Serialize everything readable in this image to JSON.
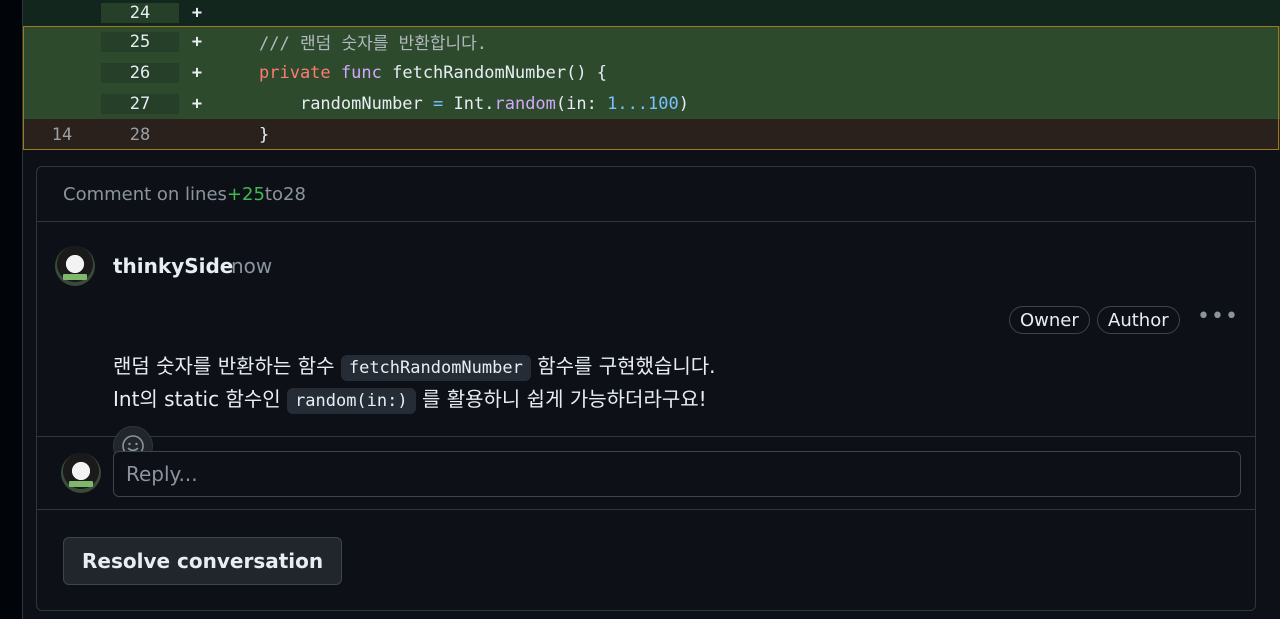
{
  "diff": {
    "rows": [
      {
        "old": "",
        "new": "24",
        "marker": "+"
      },
      {
        "old": "",
        "new": "25",
        "marker": "+"
      },
      {
        "old": "",
        "new": "26",
        "marker": "+"
      },
      {
        "old": "",
        "new": "27",
        "marker": "+"
      },
      {
        "old": "14",
        "new": "28",
        "marker": ""
      }
    ],
    "code": {
      "comment_line": "/// 랜덤 숫자를 반환합니다.",
      "private_kw": "private",
      "func_kw": "func",
      "func_name": "fetchRandomNumber() {",
      "assign_lhs": "randomNumber",
      "assign_op": "=",
      "type_name": "Int.",
      "method_name": "random",
      "arg_open": "(in: ",
      "range_value": "1...100",
      "arg_close": ")",
      "closing_brace": "}"
    }
  },
  "thread": {
    "header_prefix": "Comment on lines ",
    "header_start": "+25",
    "header_mid": " to ",
    "header_end": "28",
    "comment": {
      "author": "thinkySide",
      "time": "now",
      "badges": [
        "Owner",
        "Author"
      ],
      "more_label": "•••",
      "line1_before": "랜덤 숫자를 반환하는 함수 ",
      "line1_code": "fetchRandomNumber",
      "line1_after": " 함수를 구현했습니다.",
      "line2_before": "Int의 static 함수인 ",
      "line2_code": "random(in:)",
      "line2_after": " 를 활용하니 쉽게 가능하더라구요!"
    },
    "reply_placeholder": "Reply...",
    "resolve_label": "Resolve conversation"
  }
}
